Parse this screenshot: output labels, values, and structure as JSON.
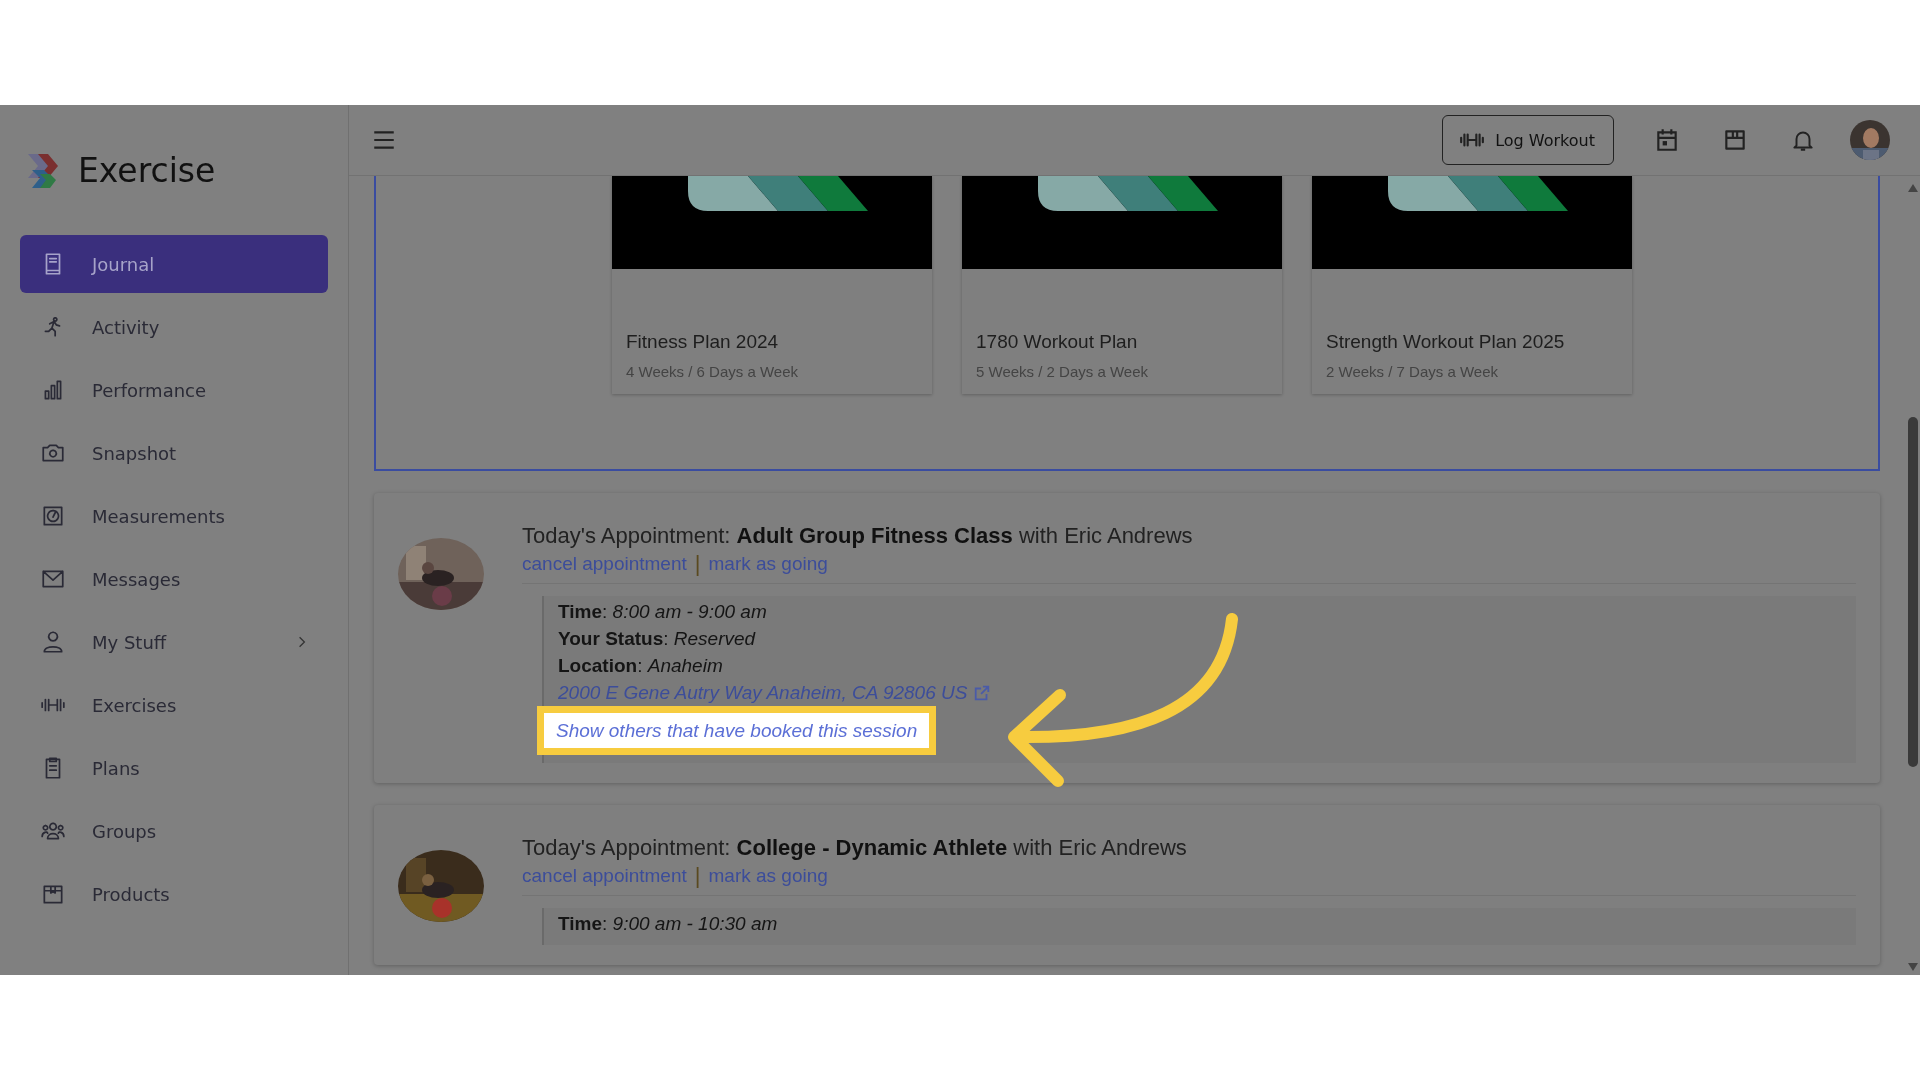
{
  "brand": {
    "name": "Exercise"
  },
  "sidebar": {
    "items": [
      {
        "label": "Journal",
        "selected": true,
        "expandable": false
      },
      {
        "label": "Activity",
        "selected": false,
        "expandable": false
      },
      {
        "label": "Performance",
        "selected": false,
        "expandable": false
      },
      {
        "label": "Snapshot",
        "selected": false,
        "expandable": false
      },
      {
        "label": "Measurements",
        "selected": false,
        "expandable": false
      },
      {
        "label": "Messages",
        "selected": false,
        "expandable": false
      },
      {
        "label": "My Stuff",
        "selected": false,
        "expandable": true
      },
      {
        "label": "Exercises",
        "selected": false,
        "expandable": false
      },
      {
        "label": "Plans",
        "selected": false,
        "expandable": false
      },
      {
        "label": "Groups",
        "selected": false,
        "expandable": false
      },
      {
        "label": "Products",
        "selected": false,
        "expandable": false
      }
    ]
  },
  "topbar": {
    "log_button": "Log Workout"
  },
  "plans": [
    {
      "title": "Fitness Plan 2024",
      "subtitle": "4 Weeks / 6 Days a Week"
    },
    {
      "title": "1780 Workout Plan",
      "subtitle": "5 Weeks / 2 Days a Week"
    },
    {
      "title": "Strength Workout Plan 2025",
      "subtitle": "2 Weeks / 7 Days a Week"
    }
  ],
  "appointments": [
    {
      "heading": "Today's Appointment: **Adult Group Fitness Class** with Eric Andrews",
      "actions": [
        "cancel appointment",
        "mark as going"
      ],
      "separator": "|",
      "details": [
        "**Time**: *8:00 am - 9:00 am*",
        "**Your Status**: *Reserved*",
        "**Location**: *Anaheim*"
      ],
      "address": "2000 E Gene Autry Way Anaheim, CA 92806 US",
      "booked_link": "Show others that have booked this session",
      "highlighted": true
    },
    {
      "heading": "Today's Appointment: **College - Dynamic Athlete** with Eric Andrews",
      "actions": [
        "cancel appointment",
        "mark as going"
      ],
      "separator": "|",
      "details": [
        "**Time**: *9:00 am - 10:30 am*"
      ],
      "highlighted": false
    }
  ]
}
